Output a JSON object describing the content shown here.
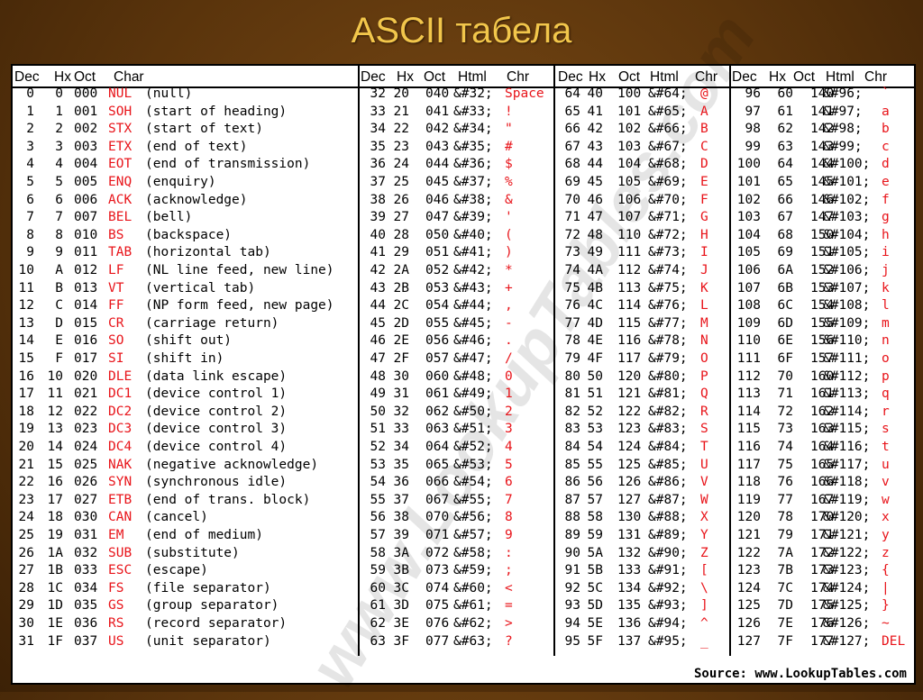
{
  "title": "ASCII табела",
  "watermark": "www.LookupTables.com",
  "source": "Source:  www.LookupTables.com",
  "colors": {
    "accent": "#e8141a",
    "title": "#f2c64b",
    "background": "#5a340c"
  },
  "headers": {
    "group1": [
      "Dec",
      "Hx",
      "Oct",
      "Char"
    ],
    "group2": [
      "Dec",
      "Hx",
      "Oct",
      "Html",
      "Chr"
    ],
    "group3": [
      "Dec",
      "Hx",
      "Oct",
      "Html",
      "Chr"
    ],
    "group4": [
      "Dec",
      "Hx",
      "Oct",
      "Html",
      "Chr"
    ]
  },
  "control_rows": [
    [
      "0",
      "0",
      "000",
      "NUL",
      "(null)"
    ],
    [
      "1",
      "1",
      "001",
      "SOH",
      "(start of heading)"
    ],
    [
      "2",
      "2",
      "002",
      "STX",
      "(start of text)"
    ],
    [
      "3",
      "3",
      "003",
      "ETX",
      "(end of text)"
    ],
    [
      "4",
      "4",
      "004",
      "EOT",
      "(end of transmission)"
    ],
    [
      "5",
      "5",
      "005",
      "ENQ",
      "(enquiry)"
    ],
    [
      "6",
      "6",
      "006",
      "ACK",
      "(acknowledge)"
    ],
    [
      "7",
      "7",
      "007",
      "BEL",
      "(bell)"
    ],
    [
      "8",
      "8",
      "010",
      "BS",
      "(backspace)"
    ],
    [
      "9",
      "9",
      "011",
      "TAB",
      "(horizontal tab)"
    ],
    [
      "10",
      "A",
      "012",
      "LF",
      "(NL line feed, new line)"
    ],
    [
      "11",
      "B",
      "013",
      "VT",
      "(vertical tab)"
    ],
    [
      "12",
      "C",
      "014",
      "FF",
      "(NP form feed, new page)"
    ],
    [
      "13",
      "D",
      "015",
      "CR",
      "(carriage return)"
    ],
    [
      "14",
      "E",
      "016",
      "SO",
      "(shift out)"
    ],
    [
      "15",
      "F",
      "017",
      "SI",
      "(shift in)"
    ],
    [
      "16",
      "10",
      "020",
      "DLE",
      "(data link escape)"
    ],
    [
      "17",
      "11",
      "021",
      "DC1",
      "(device control 1)"
    ],
    [
      "18",
      "12",
      "022",
      "DC2",
      "(device control 2)"
    ],
    [
      "19",
      "13",
      "023",
      "DC3",
      "(device control 3)"
    ],
    [
      "20",
      "14",
      "024",
      "DC4",
      "(device control 4)"
    ],
    [
      "21",
      "15",
      "025",
      "NAK",
      "(negative acknowledge)"
    ],
    [
      "22",
      "16",
      "026",
      "SYN",
      "(synchronous idle)"
    ],
    [
      "23",
      "17",
      "027",
      "ETB",
      "(end of trans. block)"
    ],
    [
      "24",
      "18",
      "030",
      "CAN",
      "(cancel)"
    ],
    [
      "25",
      "19",
      "031",
      "EM",
      "(end of medium)"
    ],
    [
      "26",
      "1A",
      "032",
      "SUB",
      "(substitute)"
    ],
    [
      "27",
      "1B",
      "033",
      "ESC",
      "(escape)"
    ],
    [
      "28",
      "1C",
      "034",
      "FS",
      "(file separator)"
    ],
    [
      "29",
      "1D",
      "035",
      "GS",
      "(group separator)"
    ],
    [
      "30",
      "1E",
      "036",
      "RS",
      "(record separator)"
    ],
    [
      "31",
      "1F",
      "037",
      "US",
      "(unit separator)"
    ]
  ],
  "group2_rows": [
    [
      "32",
      "20",
      "040",
      "&#32;",
      "Space"
    ],
    [
      "33",
      "21",
      "041",
      "&#33;",
      "!"
    ],
    [
      "34",
      "22",
      "042",
      "&#34;",
      "\""
    ],
    [
      "35",
      "23",
      "043",
      "&#35;",
      "#"
    ],
    [
      "36",
      "24",
      "044",
      "&#36;",
      "$"
    ],
    [
      "37",
      "25",
      "045",
      "&#37;",
      "%"
    ],
    [
      "38",
      "26",
      "046",
      "&#38;",
      "&"
    ],
    [
      "39",
      "27",
      "047",
      "&#39;",
      "'"
    ],
    [
      "40",
      "28",
      "050",
      "&#40;",
      "("
    ],
    [
      "41",
      "29",
      "051",
      "&#41;",
      ")"
    ],
    [
      "42",
      "2A",
      "052",
      "&#42;",
      "*"
    ],
    [
      "43",
      "2B",
      "053",
      "&#43;",
      "+"
    ],
    [
      "44",
      "2C",
      "054",
      "&#44;",
      ","
    ],
    [
      "45",
      "2D",
      "055",
      "&#45;",
      "-"
    ],
    [
      "46",
      "2E",
      "056",
      "&#46;",
      "."
    ],
    [
      "47",
      "2F",
      "057",
      "&#47;",
      "/"
    ],
    [
      "48",
      "30",
      "060",
      "&#48;",
      "0"
    ],
    [
      "49",
      "31",
      "061",
      "&#49;",
      "1"
    ],
    [
      "50",
      "32",
      "062",
      "&#50;",
      "2"
    ],
    [
      "51",
      "33",
      "063",
      "&#51;",
      "3"
    ],
    [
      "52",
      "34",
      "064",
      "&#52;",
      "4"
    ],
    [
      "53",
      "35",
      "065",
      "&#53;",
      "5"
    ],
    [
      "54",
      "36",
      "066",
      "&#54;",
      "6"
    ],
    [
      "55",
      "37",
      "067",
      "&#55;",
      "7"
    ],
    [
      "56",
      "38",
      "070",
      "&#56;",
      "8"
    ],
    [
      "57",
      "39",
      "071",
      "&#57;",
      "9"
    ],
    [
      "58",
      "3A",
      "072",
      "&#58;",
      ":"
    ],
    [
      "59",
      "3B",
      "073",
      "&#59;",
      ";"
    ],
    [
      "60",
      "3C",
      "074",
      "&#60;",
      "<"
    ],
    [
      "61",
      "3D",
      "075",
      "&#61;",
      "="
    ],
    [
      "62",
      "3E",
      "076",
      "&#62;",
      ">"
    ],
    [
      "63",
      "3F",
      "077",
      "&#63;",
      "?"
    ]
  ],
  "group3_rows": [
    [
      "64",
      "40",
      "100",
      "&#64;",
      "@"
    ],
    [
      "65",
      "41",
      "101",
      "&#65;",
      "A"
    ],
    [
      "66",
      "42",
      "102",
      "&#66;",
      "B"
    ],
    [
      "67",
      "43",
      "103",
      "&#67;",
      "C"
    ],
    [
      "68",
      "44",
      "104",
      "&#68;",
      "D"
    ],
    [
      "69",
      "45",
      "105",
      "&#69;",
      "E"
    ],
    [
      "70",
      "46",
      "106",
      "&#70;",
      "F"
    ],
    [
      "71",
      "47",
      "107",
      "&#71;",
      "G"
    ],
    [
      "72",
      "48",
      "110",
      "&#72;",
      "H"
    ],
    [
      "73",
      "49",
      "111",
      "&#73;",
      "I"
    ],
    [
      "74",
      "4A",
      "112",
      "&#74;",
      "J"
    ],
    [
      "75",
      "4B",
      "113",
      "&#75;",
      "K"
    ],
    [
      "76",
      "4C",
      "114",
      "&#76;",
      "L"
    ],
    [
      "77",
      "4D",
      "115",
      "&#77;",
      "M"
    ],
    [
      "78",
      "4E",
      "116",
      "&#78;",
      "N"
    ],
    [
      "79",
      "4F",
      "117",
      "&#79;",
      "O"
    ],
    [
      "80",
      "50",
      "120",
      "&#80;",
      "P"
    ],
    [
      "81",
      "51",
      "121",
      "&#81;",
      "Q"
    ],
    [
      "82",
      "52",
      "122",
      "&#82;",
      "R"
    ],
    [
      "83",
      "53",
      "123",
      "&#83;",
      "S"
    ],
    [
      "84",
      "54",
      "124",
      "&#84;",
      "T"
    ],
    [
      "85",
      "55",
      "125",
      "&#85;",
      "U"
    ],
    [
      "86",
      "56",
      "126",
      "&#86;",
      "V"
    ],
    [
      "87",
      "57",
      "127",
      "&#87;",
      "W"
    ],
    [
      "88",
      "58",
      "130",
      "&#88;",
      "X"
    ],
    [
      "89",
      "59",
      "131",
      "&#89;",
      "Y"
    ],
    [
      "90",
      "5A",
      "132",
      "&#90;",
      "Z"
    ],
    [
      "91",
      "5B",
      "133",
      "&#91;",
      "["
    ],
    [
      "92",
      "5C",
      "134",
      "&#92;",
      "\\"
    ],
    [
      "93",
      "5D",
      "135",
      "&#93;",
      "]"
    ],
    [
      "94",
      "5E",
      "136",
      "&#94;",
      "^"
    ],
    [
      "95",
      "5F",
      "137",
      "&#95;",
      "_"
    ]
  ],
  "group4_rows": [
    [
      "96",
      "60",
      "140",
      "&#96;",
      "`"
    ],
    [
      "97",
      "61",
      "141",
      "&#97;",
      "a"
    ],
    [
      "98",
      "62",
      "142",
      "&#98;",
      "b"
    ],
    [
      "99",
      "63",
      "143",
      "&#99;",
      "c"
    ],
    [
      "100",
      "64",
      "144",
      "&#100;",
      "d"
    ],
    [
      "101",
      "65",
      "145",
      "&#101;",
      "e"
    ],
    [
      "102",
      "66",
      "146",
      "&#102;",
      "f"
    ],
    [
      "103",
      "67",
      "147",
      "&#103;",
      "g"
    ],
    [
      "104",
      "68",
      "150",
      "&#104;",
      "h"
    ],
    [
      "105",
      "69",
      "151",
      "&#105;",
      "i"
    ],
    [
      "106",
      "6A",
      "152",
      "&#106;",
      "j"
    ],
    [
      "107",
      "6B",
      "153",
      "&#107;",
      "k"
    ],
    [
      "108",
      "6C",
      "154",
      "&#108;",
      "l"
    ],
    [
      "109",
      "6D",
      "155",
      "&#109;",
      "m"
    ],
    [
      "110",
      "6E",
      "156",
      "&#110;",
      "n"
    ],
    [
      "111",
      "6F",
      "157",
      "&#111;",
      "o"
    ],
    [
      "112",
      "70",
      "160",
      "&#112;",
      "p"
    ],
    [
      "113",
      "71",
      "161",
      "&#113;",
      "q"
    ],
    [
      "114",
      "72",
      "162",
      "&#114;",
      "r"
    ],
    [
      "115",
      "73",
      "163",
      "&#115;",
      "s"
    ],
    [
      "116",
      "74",
      "164",
      "&#116;",
      "t"
    ],
    [
      "117",
      "75",
      "165",
      "&#117;",
      "u"
    ],
    [
      "118",
      "76",
      "166",
      "&#118;",
      "v"
    ],
    [
      "119",
      "77",
      "167",
      "&#119;",
      "w"
    ],
    [
      "120",
      "78",
      "170",
      "&#120;",
      "x"
    ],
    [
      "121",
      "79",
      "171",
      "&#121;",
      "y"
    ],
    [
      "122",
      "7A",
      "172",
      "&#122;",
      "z"
    ],
    [
      "123",
      "7B",
      "173",
      "&#123;",
      "{"
    ],
    [
      "124",
      "7C",
      "174",
      "&#124;",
      "|"
    ],
    [
      "125",
      "7D",
      "175",
      "&#125;",
      "}"
    ],
    [
      "126",
      "7E",
      "176",
      "&#126;",
      "~"
    ],
    [
      "127",
      "7F",
      "177",
      "&#127;",
      "DEL"
    ]
  ]
}
